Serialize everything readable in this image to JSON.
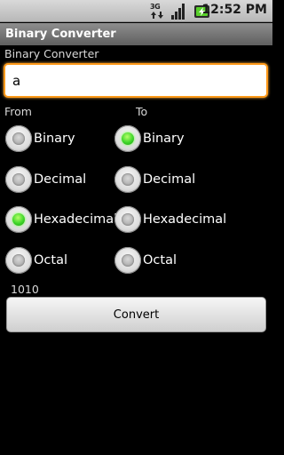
{
  "status_bar": {
    "network_label": "3G",
    "time": "12:52 PM",
    "icons": [
      "3g-data-icon",
      "signal-strength-icon",
      "battery-charging-icon"
    ]
  },
  "title_bar": {
    "title": "Binary Converter"
  },
  "app": {
    "label": "Binary Converter",
    "input": {
      "value": "a",
      "placeholder": ""
    },
    "from_label": "From",
    "to_label": "To",
    "from_options": [
      {
        "label": "Binary",
        "selected": false
      },
      {
        "label": "Decimal",
        "selected": false
      },
      {
        "label": "Hexadecimal",
        "selected": true
      },
      {
        "label": "Octal",
        "selected": false
      }
    ],
    "to_options": [
      {
        "label": "Binary",
        "selected": true
      },
      {
        "label": "Decimal",
        "selected": false
      },
      {
        "label": "Hexadecimal",
        "selected": false
      },
      {
        "label": "Octal",
        "selected": false
      }
    ],
    "result": "1010",
    "convert_label": "Convert"
  },
  "colors": {
    "focus_border": "#ff9a1a",
    "radio_selected": "#3fd62a"
  }
}
